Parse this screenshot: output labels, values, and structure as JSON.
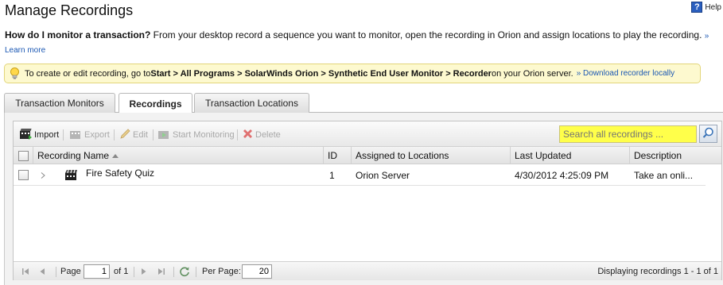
{
  "page": {
    "title": "Manage Recordings",
    "help_label": "Help"
  },
  "intro": {
    "question": "How do I monitor a transaction?",
    "text": " From your desktop record a sequence you want to monitor, open the recording in Orion and assign locations to play the recording.",
    "learn_more": "» Learn more"
  },
  "tip": {
    "prefix": "To create or edit recording, go to ",
    "path": "Start > All Programs > SolarWinds Orion > Synthetic End User Monitor > Recorder",
    "suffix": " on your Orion server.",
    "download_link": "» Download recorder locally"
  },
  "tabs": [
    {
      "label": "Transaction Monitors",
      "active": false
    },
    {
      "label": "Recordings",
      "active": true
    },
    {
      "label": "Transaction Locations",
      "active": false
    }
  ],
  "toolbar": {
    "import": "Import",
    "export": "Export",
    "edit": "Edit",
    "start_monitoring": "Start Monitoring",
    "delete": "Delete",
    "search_placeholder": "Search all recordings ..."
  },
  "table": {
    "columns": {
      "name": "Recording Name",
      "id": "ID",
      "assigned": "Assigned to Locations",
      "last_updated": "Last Updated",
      "description": "Description"
    },
    "rows": [
      {
        "name": "Fire Safety Quiz",
        "id": "1",
        "assigned": "Orion Server",
        "last_updated": "4/30/2012 4:25:09 PM",
        "description": "Take an onli..."
      }
    ]
  },
  "pager": {
    "page_label": "Page",
    "page_value": "1",
    "of_label": "of 1",
    "per_page_label": "Per Page:",
    "per_page_value": "20",
    "displaying": "Displaying recordings 1 - 1 of 1"
  },
  "colors": {
    "search_highlight": "#ffff4a",
    "tip_background": "#fdf9cf",
    "link": "#1a57b3"
  }
}
